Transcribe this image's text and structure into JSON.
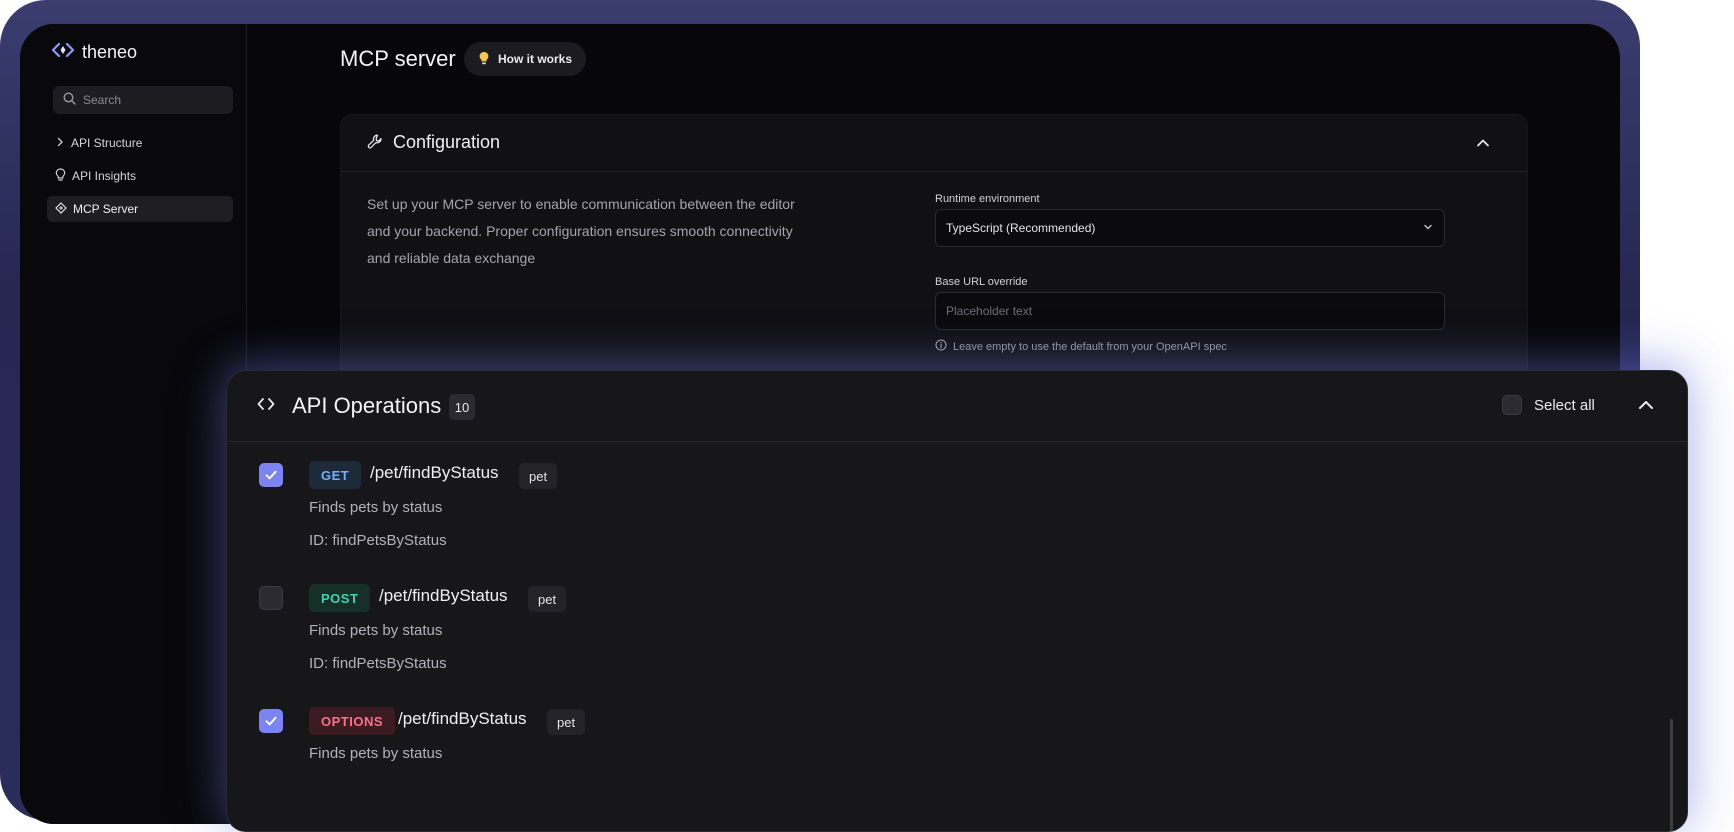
{
  "brand": {
    "name": "theneo",
    "accent": "#7b84f2"
  },
  "sidebar": {
    "search_placeholder": "Search",
    "items": [
      {
        "label": "API Structure",
        "icon": "chevron-right-icon"
      },
      {
        "label": "API Insights",
        "icon": "lightbulb-icon"
      },
      {
        "label": "MCP Server",
        "icon": "mcp-icon",
        "active": true
      }
    ]
  },
  "header": {
    "title": "MCP server",
    "how_it_works": "How it works"
  },
  "configuration": {
    "title": "Configuration",
    "description": "Set up your MCP server to enable communication between the editor and your backend. Proper configuration ensures smooth connectivity and reliable data exchange",
    "runtime_label": "Runtime environment",
    "runtime_value": "TypeScript (Recommended)",
    "base_url_label": "Base URL override",
    "base_url_placeholder": "Placeholder text",
    "base_url_value": "",
    "hint": "Leave empty to use the default from your OpenAPI spec"
  },
  "operations": {
    "title": "API Operations",
    "count": "10",
    "select_all": "Select all",
    "items": [
      {
        "checked": true,
        "method": "GET",
        "method_color": "#6fb0ff",
        "method_bg": "#1c2a3a",
        "path": "/pet/findByStatus",
        "tag": "pet",
        "description": "Finds pets by status",
        "id": "ID: findPetsByStatus"
      },
      {
        "checked": false,
        "method": "POST",
        "method_color": "#3ed6b0",
        "method_bg": "#163028",
        "path": "/pet/findByStatus",
        "tag": "pet",
        "description": "Finds pets by status",
        "id": "ID: findPetsByStatus"
      },
      {
        "checked": true,
        "method": "OPTIONS",
        "method_color": "#ff6f86",
        "method_bg": "#3a1c22",
        "path": "/pet/findByStatus",
        "tag": "pet",
        "description": "Finds pets by status",
        "id": ""
      }
    ]
  }
}
